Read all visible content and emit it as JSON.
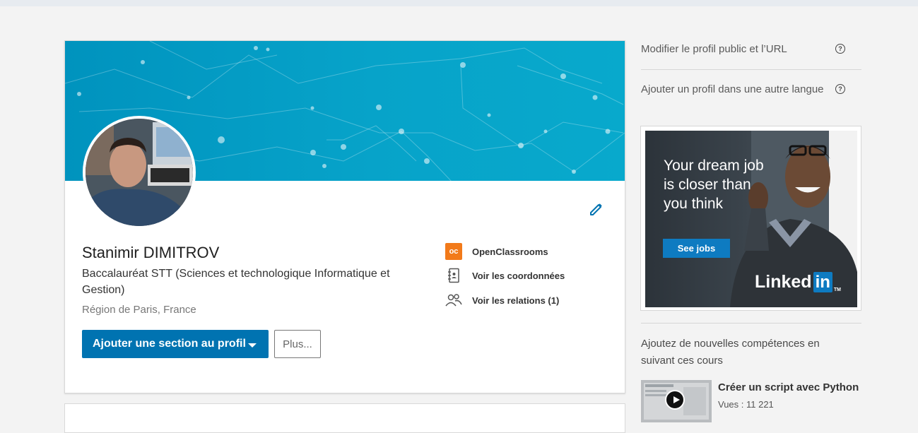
{
  "profile": {
    "name": "Stanimir DIMITROV",
    "headline": "Baccalauréat STT (Sciences et technologique Informatique et Gestion)",
    "location": "Région de Paris, France",
    "add_section_label": "Ajouter une section au profil",
    "more_label": "Plus...",
    "links": {
      "school": "OpenClassrooms",
      "school_logo": "oc",
      "contact": "Voir les coordonnées",
      "connections": "Voir les relations (1)"
    }
  },
  "rail": {
    "public_profile_label": "Modifier le profil public et l’URL",
    "add_language_label": "Ajouter un profil dans une autre langue",
    "help_glyph": "?",
    "ad": {
      "text": "Your dream job is closer than you think",
      "button": "See jobs",
      "logo_word": "Linked",
      "logo_in": "in",
      "logo_tm": "TM"
    },
    "courses": {
      "title": "Ajoutez de nouvelles compétences en suivant ces cours",
      "items": [
        {
          "name": "Créer un script avec Python",
          "views": "Vues : 11 221"
        }
      ]
    }
  },
  "icons": {
    "edit": "pencil-icon",
    "contact": "contact-card-icon",
    "connections": "people-icon",
    "help": "question-circle-icon",
    "play": "play-icon",
    "dropdown": "caret-down-icon"
  },
  "colors": {
    "primary": "#0073b1",
    "banner": "#079fc8",
    "oc_orange": "#f27a1a",
    "linkedin_blue": "#0e7bc1"
  }
}
